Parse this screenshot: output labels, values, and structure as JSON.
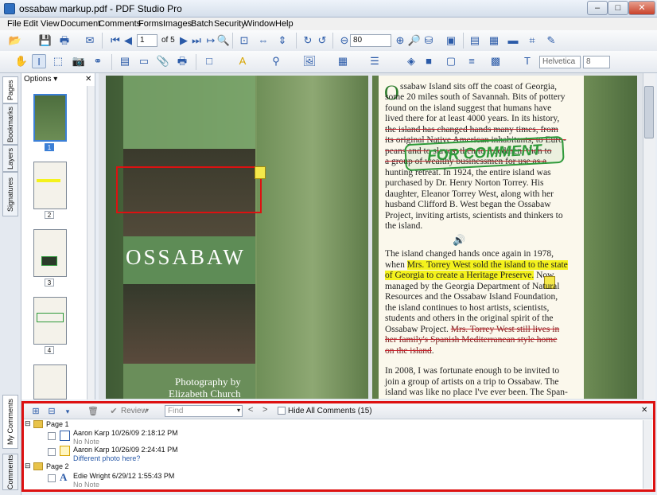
{
  "window": {
    "title": "ossabaw markup.pdf - PDF Studio Pro",
    "minimize": "–",
    "maximize": "□",
    "close": "✕"
  },
  "menu": [
    "File",
    "Edit",
    "View",
    "Document",
    "Comments",
    "Forms",
    "Images",
    "Batch",
    "Security",
    "Window",
    "Help"
  ],
  "toolbar": {
    "page_value": "1",
    "page_of": "of 5",
    "zoom_value": "80",
    "font_value": "Helvetica",
    "font_size_value": "8"
  },
  "sidebar": {
    "tabs": [
      "Pages",
      "Bookmarks",
      "Layers",
      "Signatures"
    ],
    "bottom_tabs": [
      "My Comments",
      "Comments"
    ],
    "options_label": "Options ▾",
    "thumbnails": [
      "1",
      "2",
      "3",
      "4"
    ]
  },
  "document": {
    "cover_title": "OSSABAW",
    "cover_credit_1": "Photography by",
    "cover_credit_2": "Elizabeth Church",
    "stamp_text": "FOR COMMENT",
    "drop_cap": "O",
    "p1": [
      "ssabaw Island sits off the coast of Georgia,",
      "some 20 miles south of Savannah. Bits of pottery",
      "found on the island suggest that humans have",
      "lived there for at least 4000 years. In its history,",
      "the island has changed hands many times, from",
      "its original Native American inhabitants, to Euro-",
      "peans and to slaves, then to freedmen, then to",
      "a group of wealthy businessmen for use as a",
      "hunting retreat. In 1924, the entire island was",
      "purchased by Dr. Henry Norton Torrey. His",
      "daughter, Eleanor Torrey West, along with her",
      "husband Clifford B. West began the Ossabaw",
      "Project, inviting artists, scientists and thinkers to",
      "the island."
    ],
    "p2_line1_pre": "The island changed hands once again in 1978,",
    "p2_line2_pre": "when ",
    "p2_line2_hl": "Mrs. Torrey West sold the island to the state",
    "p2_line3_hl": "of Georgia to create a Heritage Preserve.",
    "p2_line3_post": " Now",
    "p2_rest": [
      "managed by the Georgia Department of Natural",
      "Resources and the Ossabaw Island Foundation,",
      "the island continues to host artists, scientists,",
      "students and others in the original spirit of the"
    ],
    "p2_last_pre": "Ossabaw Project. ",
    "p2_strike1": "Mrs. Torrey West still lives in",
    "p2_strike2": "her family's Spanish Mediterranean style home",
    "p2_strike3": "on the island",
    "p2_end": ".",
    "p3": [
      "In 2008, I was fortunate enough to be invited to",
      "join a group of artists on a trip to Ossabaw. The",
      "island was like no place I've ever been. The Span-"
    ]
  },
  "comments_panel": {
    "review_label": "Review",
    "find_placeholder": "Find",
    "hide_all_label": "Hide All Comments (15)",
    "groups": [
      {
        "page": "Page 1",
        "items": [
          {
            "author": "Aaron Karp 10/26/09 2:18:12 PM",
            "note": "No Note"
          },
          {
            "author": "Aaron Karp 10/26/09 2:24:41 PM",
            "note": "Different photo here?"
          }
        ]
      },
      {
        "page": "Page 2",
        "items": [
          {
            "author": "Edie Wright 6/29/12 1:55:43 PM",
            "note": "No Note"
          }
        ]
      }
    ]
  },
  "colors": {
    "accent": "#2a5aa8",
    "highlight": "#f4f21c",
    "stamp": "#2e9a3a",
    "strike": "#c8202a",
    "panel_border": "#dd1111"
  }
}
